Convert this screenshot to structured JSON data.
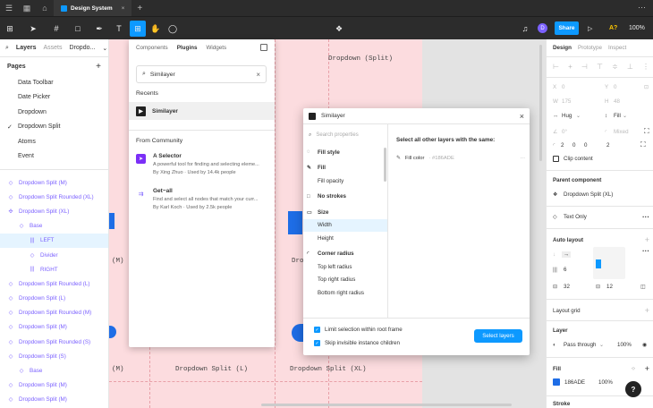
{
  "tabbar": {
    "file_tab": "Design System",
    "close": "×",
    "new_tab": "+",
    "more": "⋯"
  },
  "toolbar": {
    "share": "Share",
    "avatar": "D",
    "play": "▷",
    "a7": "A?",
    "zoom": "100%"
  },
  "left": {
    "tabs": [
      "Layers",
      "Assets",
      "Dropdo..."
    ],
    "pages_title": "Pages",
    "pages": [
      "Data Toolbar",
      "Date Picker",
      "Dropdown",
      "Dropdown Split",
      "Atoms",
      "Event"
    ],
    "current_page": "Dropdown Split",
    "layers": [
      {
        "label": "Dropdown Split (M)",
        "indent": 1,
        "icon": "◇"
      },
      {
        "label": "Dropdown Split Rounded (XL)",
        "indent": 1,
        "icon": "◇"
      },
      {
        "label": "Dropdown Split (XL)",
        "indent": 1,
        "icon": "✣"
      },
      {
        "label": "Base",
        "indent": 2,
        "icon": "◇"
      },
      {
        "label": "LEFT",
        "indent": 3,
        "icon": "|||"
      },
      {
        "label": "Divider",
        "indent": 3,
        "icon": "◇"
      },
      {
        "label": "RIGHT",
        "indent": 3,
        "icon": "|||"
      },
      {
        "label": "Dropdown Split Rounded (L)",
        "indent": 1,
        "icon": "◇"
      },
      {
        "label": "Dropdown Split (L)",
        "indent": 1,
        "icon": "◇"
      },
      {
        "label": "Dropdown Split Rounded (M)",
        "indent": 1,
        "icon": "◇"
      },
      {
        "label": "Dropdown Split (M)",
        "indent": 1,
        "icon": "◇"
      },
      {
        "label": "Dropdown Split Rounded (S)",
        "indent": 1,
        "icon": "◇"
      },
      {
        "label": "Dropdown Split (S)",
        "indent": 1,
        "icon": "◇"
      },
      {
        "label": "Base",
        "indent": 2,
        "icon": "◇"
      },
      {
        "label": "Dropdown Split (M)",
        "indent": 1,
        "icon": "◇"
      },
      {
        "label": "Dropdown Split (M)",
        "indent": 1,
        "icon": "◇"
      },
      {
        "label": "Dropdown Split (M)",
        "indent": 1,
        "icon": "◇"
      }
    ]
  },
  "canvas": {
    "label_top": "Dropdown (Split)",
    "label_m1": "(M)",
    "label_d": "Dropd",
    "label_m2": "(M)",
    "label_l": "Dropdown Split (L)",
    "label_xl": "Dropdown Split (XL)"
  },
  "plugins": {
    "tabs": [
      "Components",
      "Plugins",
      "Widgets"
    ],
    "search_value": "Similayer",
    "recents_title": "Recents",
    "recent_item": "Similayer",
    "community_title": "From Community",
    "items": [
      {
        "name": "A Selector",
        "desc": "A powerful tool for finding and selecting eleme...",
        "by": "By Xing Zhuo · Used by 14.4k people"
      },
      {
        "name": "Get~all",
        "desc": "Find and select all nodes that match your curr...",
        "by": "By Karl Koch · Used by 2.5k people"
      }
    ]
  },
  "dialog": {
    "title": "Similayer",
    "search_placeholder": "Search properties",
    "right_title": "Select all other layers with the same:",
    "fill_color_label": "Fill color",
    "fill_color_value": "· #186ADE",
    "fill_more": "···",
    "options": [
      {
        "label": "Fill style",
        "hdr": true,
        "icon": "◌"
      },
      {
        "label": "Fill",
        "hdr": true,
        "icon": "✎"
      },
      {
        "label": "Fill opacity",
        "hdr": false,
        "icon": ""
      },
      {
        "label": "No strokes",
        "hdr": true,
        "icon": "□"
      },
      {
        "label": "Size",
        "hdr": true,
        "icon": "▭"
      },
      {
        "label": "Width",
        "hdr": false,
        "icon": "",
        "sel": true
      },
      {
        "label": "Height",
        "hdr": false,
        "icon": ""
      },
      {
        "label": "Corner radius",
        "hdr": true,
        "icon": "◜"
      },
      {
        "label": "Top left radius",
        "hdr": false,
        "icon": ""
      },
      {
        "label": "Top right radius",
        "hdr": false,
        "icon": ""
      },
      {
        "label": "Bottom right radius",
        "hdr": false,
        "icon": ""
      }
    ],
    "check1": "Limit selection within root frame",
    "check2": "Skip invisible instance children",
    "select_btn": "Select layers"
  },
  "right": {
    "tabs": [
      "Design",
      "Prototype",
      "Inspect"
    ],
    "x_label": "X",
    "x_val": "0",
    "y_label": "Y",
    "y_val": "0",
    "w_label": "W",
    "w_val": "175",
    "h_label": "H",
    "h_val": "48",
    "hug": "Hug",
    "fill": "Fill",
    "rot": "0°",
    "mixed": "Mixed",
    "corners": [
      "2",
      "0",
      "0",
      "2"
    ],
    "clip": "Clip content",
    "parent_title": "Parent component",
    "parent_name": "Dropdown Split (XL)",
    "text_only": "Text Only",
    "autolayout_title": "Auto layout",
    "gap": "6",
    "pad_h": "32",
    "pad_v": "12",
    "layout_grid": "Layout grid",
    "layer_title": "Layer",
    "blend": "Pass through",
    "opacity": "100%",
    "fill_title": "Fill",
    "fill_hex": "186ADE",
    "fill_opacity": "100%",
    "stroke_title": "Stroke"
  },
  "help": "?"
}
